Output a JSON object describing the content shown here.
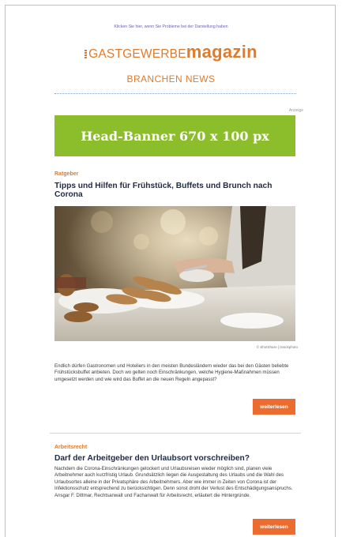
{
  "header": {
    "click_link": "Klicken Sie hier, wenn Sie Probleme bei der Darstellung haben",
    "logo_gastgewerbe": "GASTGEWERBE",
    "logo_magazin": "magazin",
    "subtitle": "BRANCHEN NEWS"
  },
  "ad": {
    "label": "Anzeige",
    "banner_text": "Head-Banner 670 x 100 px"
  },
  "articles": [
    {
      "category": "Ratgeber",
      "title": "Tipps und Hilfen für Frühstück, Buffets und Brunch nach Corona",
      "image_credit": "© ShotShare | istockphoto",
      "text": "Endlich dürfen Gastronomen und Hoteliers in den meisten Bundesländern wieder das bei den Gästen beliebte Frühstücksbuffet anbieten. Doch wo gelten noch Einschränkungen, welche Hygiene-Maßnahmen müssen umgesetzt werden und wie wird das Buffet an die neuen Regeln angepasst?",
      "button": "weiterlesen"
    },
    {
      "category": "Arbeitsrecht",
      "title": "Darf der Arbeitgeber den Urlaubsort vorschreiben?",
      "text": "Nachdem die Corona-Einschränkungen gelockert und Urlaubsreisen wieder möglich sind, planen viele Arbeitnehmer auch kurzfristig Urlaub. Grundsätzlich liegen die Ausgestaltung des Urlaubs und die Wahl des Urlaubsortes alleine in der Privatsphäre des Arbeitnehmers. Aber wie immer in Zeiten von Corona ist der Infektionsschutz entsprechend zu berücksichtigen. Denn sonst droht der Verlust des Entschädigungsanspruchs. Ansgar F. Dittmar, Rechtsanwalt und Fachanwalt für Arbeitsrecht, erläutert die Hintergründe.",
      "button": "weiterlesen"
    }
  ],
  "colors": {
    "accent": "#e07b2c",
    "button": "#ec6c2f",
    "banner": "#8cbd2a",
    "headline": "#1f2a44",
    "link": "#6b5fb0"
  }
}
